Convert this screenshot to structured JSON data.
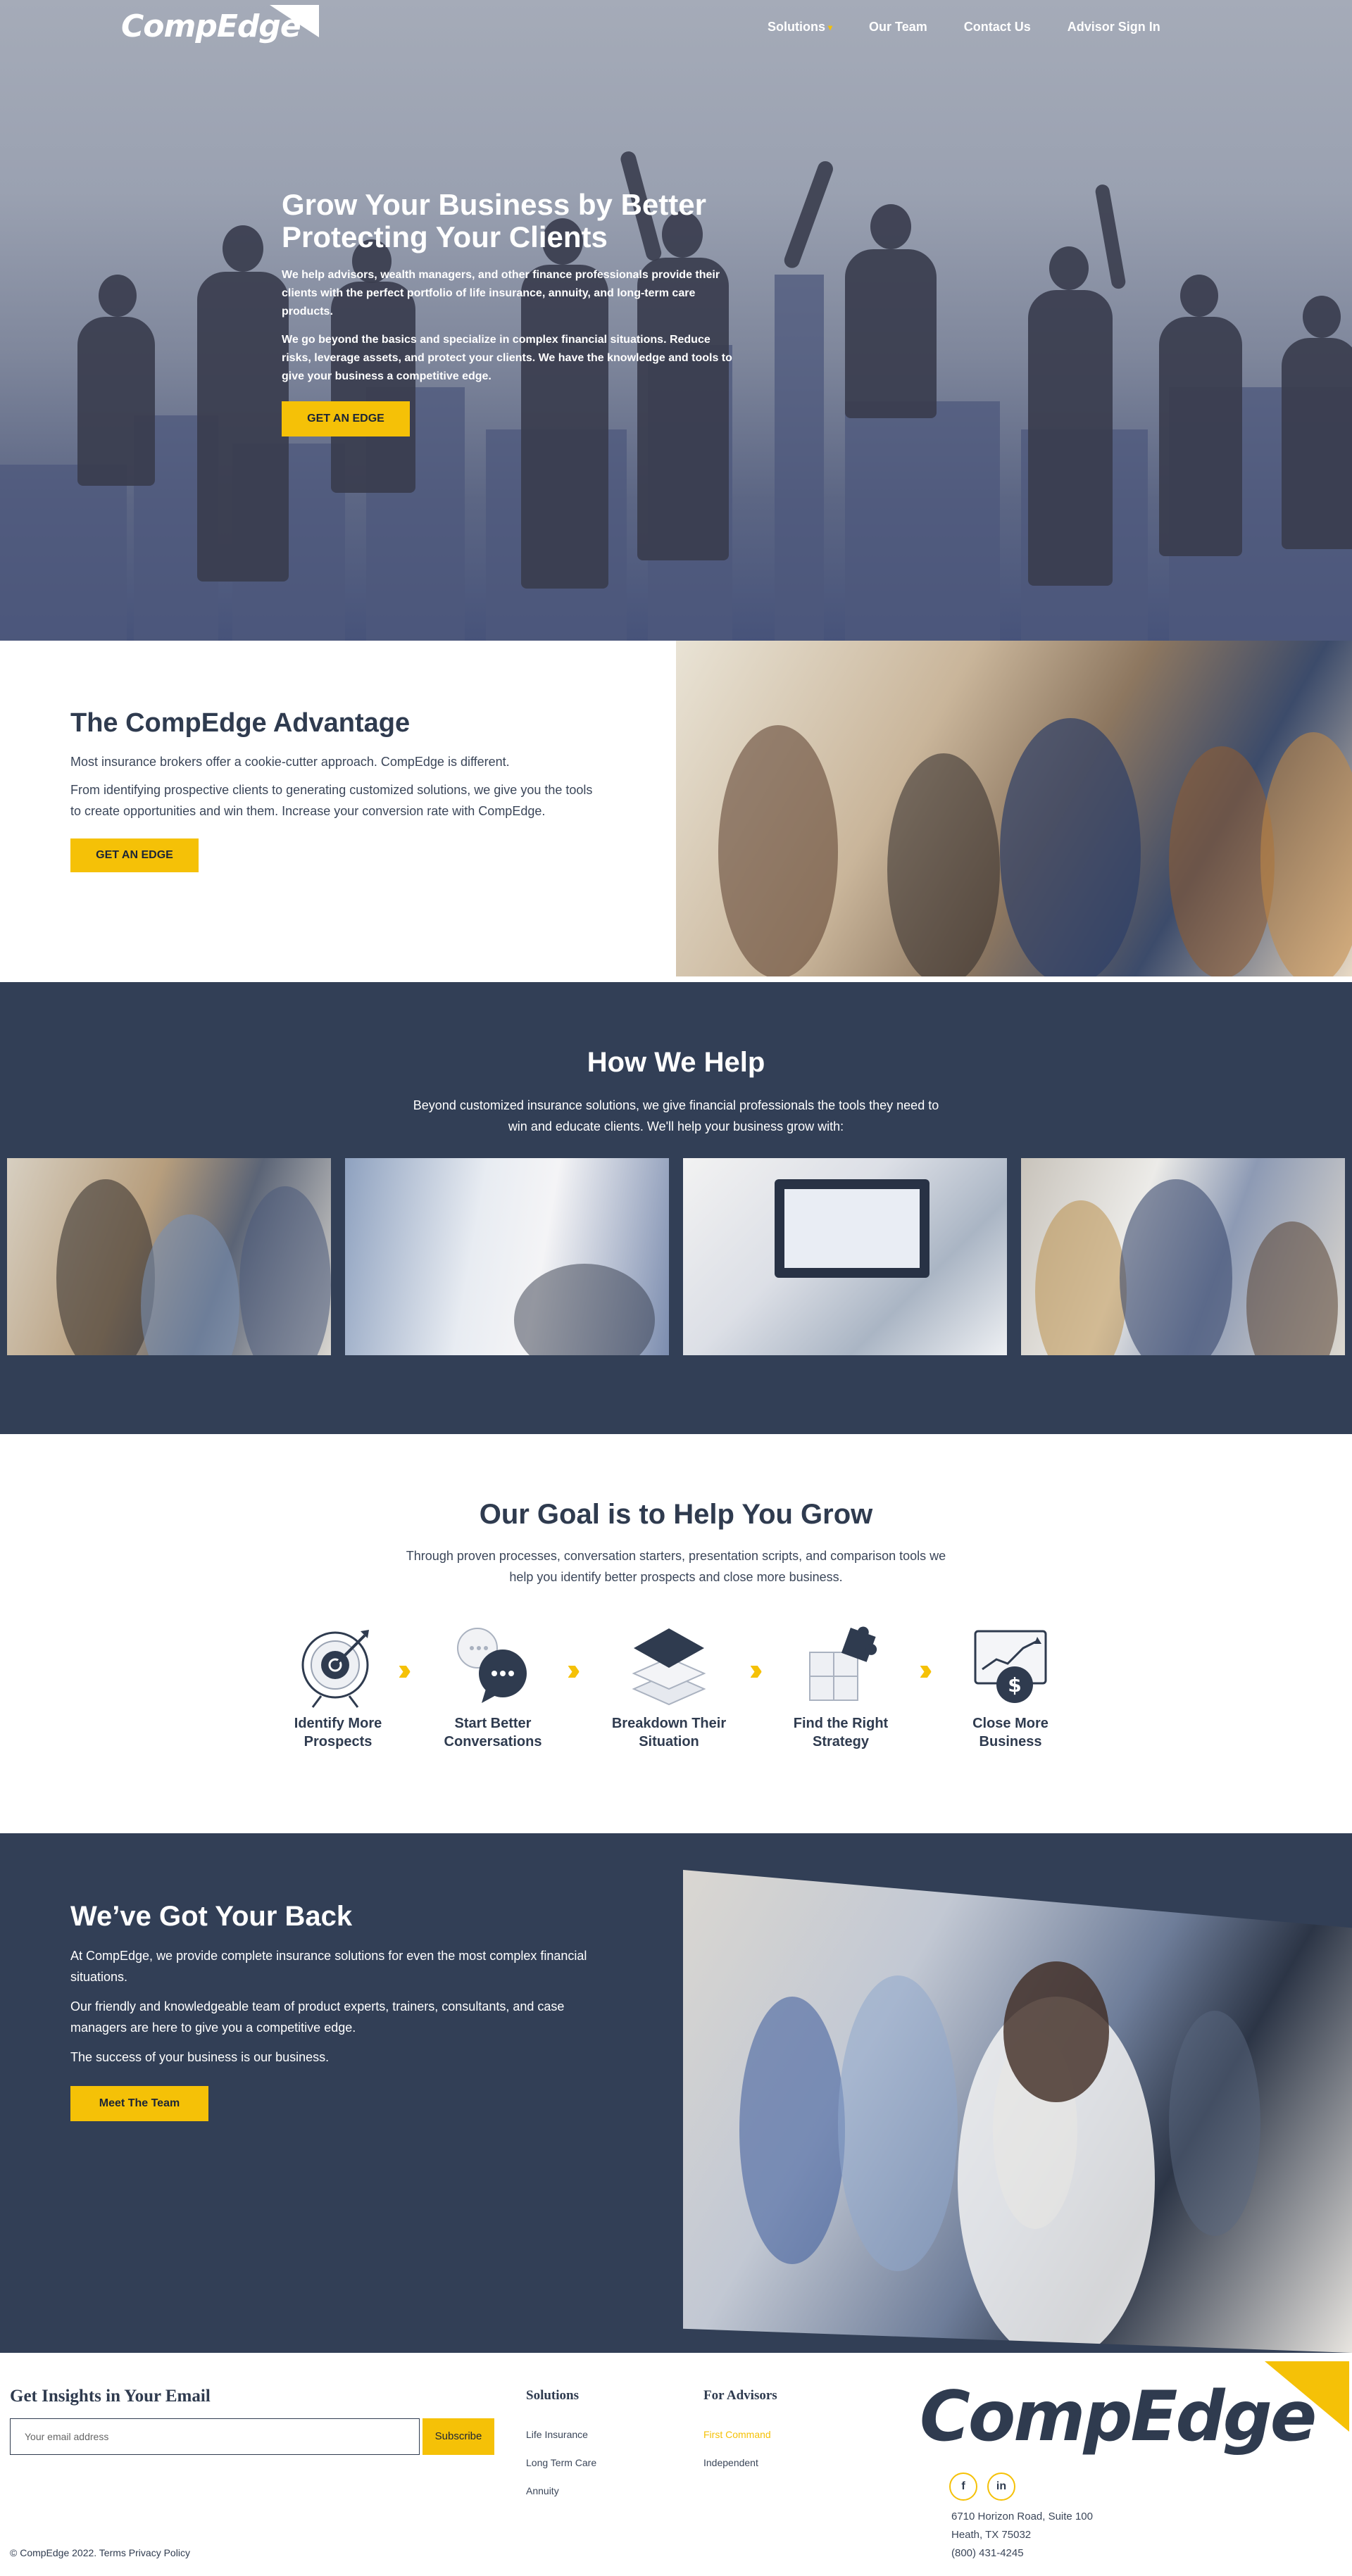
{
  "nav": {
    "logo": "CompEdge",
    "links": [
      "Solutions",
      "Our Team",
      "Contact Us",
      "Advisor Sign In"
    ]
  },
  "hero": {
    "title": "Grow Your Business by Better Protecting Your Clients",
    "p1": "We help advisors, wealth managers, and other finance professionals provide their clients with the perfect portfolio of life insurance, annuity, and long-term care products.",
    "p2": "We go beyond the basics and specialize in complex financial situations. Reduce risks, leverage assets, and protect your clients. We have the knowledge and tools to give your business a competitive edge.",
    "button": "GET AN EDGE"
  },
  "advantage": {
    "title": "The CompEdge Advantage",
    "p1": "Most insurance brokers offer a cookie-cutter approach. CompEdge is different.",
    "p2": "From identifying prospective clients to generating customized solutions, we give you the tools to create opportunities and win them. Increase your conversion rate with CompEdge.",
    "button": "GET AN EDGE"
  },
  "help": {
    "title": "How We Help",
    "subtitle": "Beyond customized insurance solutions, we give financial professionals the tools they need to win and educate clients. We'll help your business grow with:"
  },
  "goal": {
    "title": "Our Goal is to Help You Grow",
    "subtitle": "Through proven processes, conversation starters, presentation scripts, and comparison tools we help you identify better prospects and close more business.",
    "steps": [
      {
        "label": "Identify More Prospects",
        "icon": "target-icon"
      },
      {
        "label": "Start Better Conversations",
        "icon": "chat-bubbles-icon"
      },
      {
        "label": "Breakdown Their Situation",
        "icon": "layers-icon"
      },
      {
        "label": "Find the Right Strategy",
        "icon": "puzzle-icon"
      },
      {
        "label": "Close More Business",
        "icon": "dollar-chart-icon"
      }
    ],
    "arrow": "››"
  },
  "back": {
    "title": "We’ve Got Your Back",
    "p1": "At CompEdge, we provide complete insurance solutions for even the most complex financial situations.",
    "p2": "Our friendly and knowledgeable team of product experts, trainers, consultants, and case managers are here to give you a competitive edge.",
    "p3": "The success of your business is our business.",
    "button": "Meet The Team"
  },
  "footer": {
    "newsletter_title": "Get Insights in Your Email",
    "email_placeholder": "Your email address",
    "subscribe": "Subscribe",
    "copyright": "© CompEdge 2022. Terms Privacy Policy",
    "solutions_title": "Solutions",
    "solutions": [
      "Life Insurance",
      "Long Term Care",
      "Annuity"
    ],
    "advisors_title": "For Advisors",
    "advisors": [
      "First Command",
      "Independent"
    ],
    "logo": "CompEdge",
    "social": [
      "f",
      "in"
    ],
    "address1": "6710 Horizon Road, Suite 100",
    "address2": "Heath, TX 75032",
    "phone": "(800) 431-4245"
  },
  "colors": {
    "accent": "#f5c107",
    "navy": "#323f56",
    "text": "#2f3b4f"
  }
}
